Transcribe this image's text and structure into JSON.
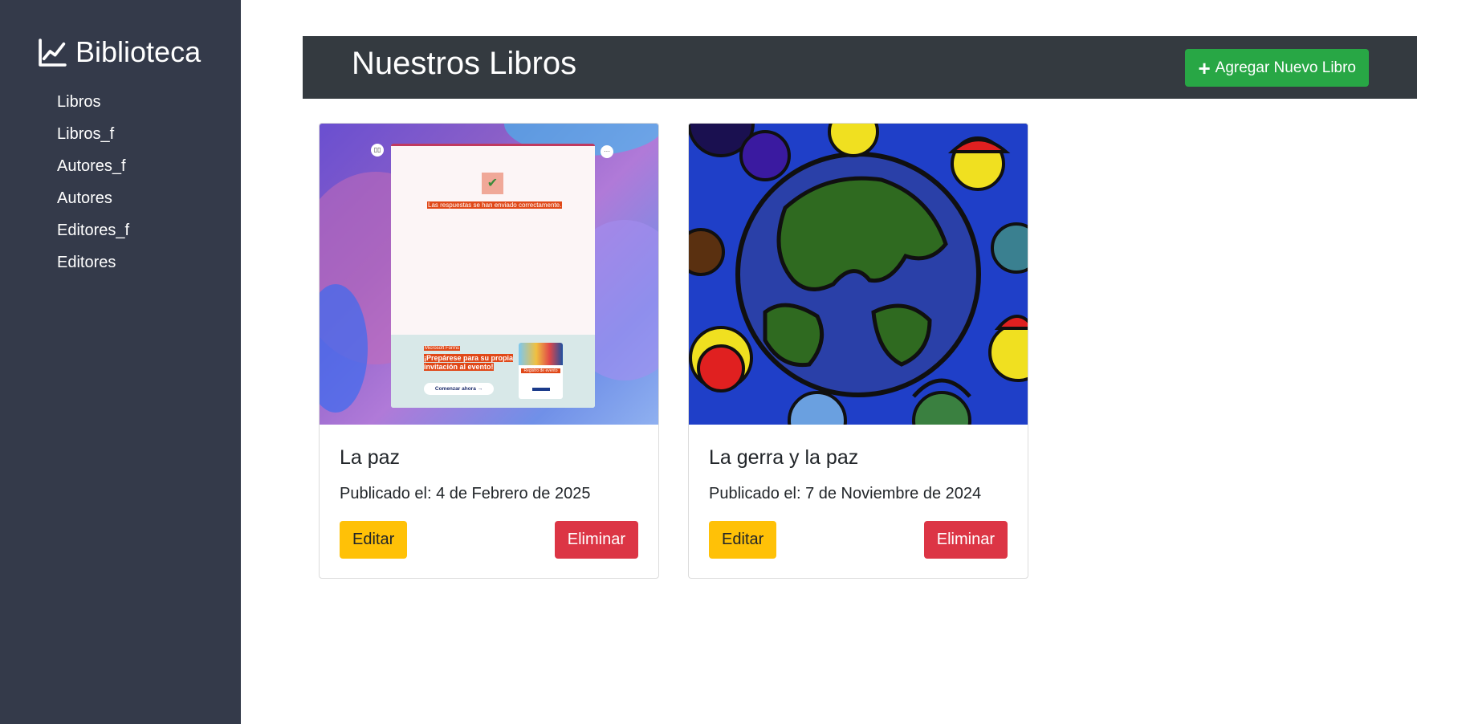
{
  "sidebar": {
    "brand": "Biblioteca",
    "brand_icon": "line-chart-icon",
    "items": [
      {
        "label": "Libros"
      },
      {
        "label": "Libros_f"
      },
      {
        "label": "Autores_f"
      },
      {
        "label": "Autores"
      },
      {
        "label": "Editores_f"
      },
      {
        "label": "Editores"
      }
    ]
  },
  "header": {
    "title": "Nuestros Libros",
    "add_button": "Agregar Nuevo Libro",
    "add_icon": "plus-icon"
  },
  "books": [
    {
      "title": "La paz",
      "date": "Publicado el: 4 de Febrero de 2025",
      "edit_label": "Editar",
      "delete_label": "Eliminar",
      "image": {
        "success_text": "Las respuestas se han enviado correctamente.",
        "brand_text": "Microsoft Forms",
        "promo_text": "¡Prepárese para su propia invitación al evento!",
        "start_button": "Comenzar ahora",
        "card_label": "Registro de evento"
      }
    },
    {
      "title": "La gerra y la paz",
      "date": "Publicado el: 7 de Noviembre de 2024",
      "edit_label": "Editar",
      "delete_label": "Eliminar"
    }
  ],
  "colors": {
    "sidebar_bg": "#343a4a",
    "header_bg": "#343a40",
    "success": "#28a745",
    "warning": "#ffc107",
    "danger": "#dc3545"
  }
}
